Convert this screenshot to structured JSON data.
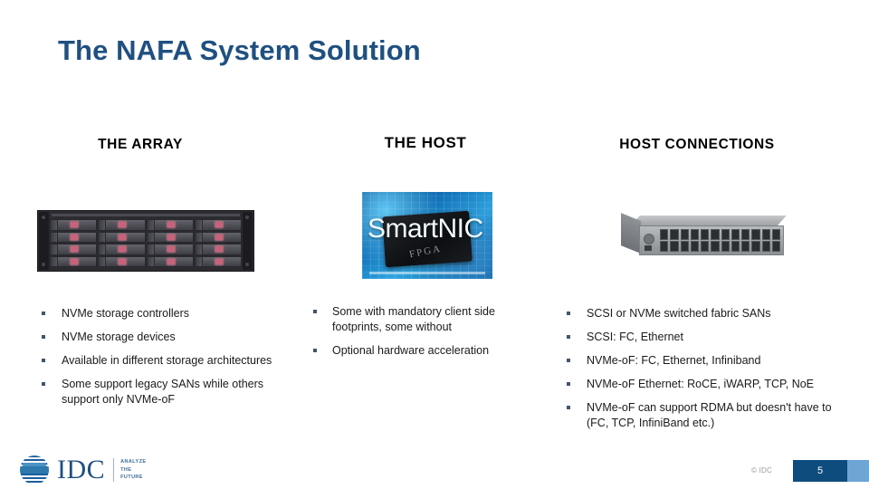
{
  "slide": {
    "title": "The NAFA System Solution"
  },
  "columns": [
    {
      "header": "THE ARRAY",
      "image": {
        "name": "storage-array-image",
        "alt": "Rack-mount NVMe storage array with 16 drive bays"
      },
      "bullets": [
        "NVMe storage controllers",
        "NVMe storage devices",
        "Available in different storage architectures",
        "Some support legacy SANs while others support only NVMe-oF"
      ]
    },
    {
      "header": "THE HOST",
      "image": {
        "name": "smartnic-image",
        "alt": "SmartNIC circuit board with FPGA chip",
        "caption": "SmartNIC",
        "chip_label": "FPGA"
      },
      "bullets": [
        "Some with mandatory client side footprints, some without",
        "Optional hardware acceleration"
      ]
    },
    {
      "header": "HOST CONNECTIONS",
      "image": {
        "name": "network-switch-image",
        "alt": "Rack-mount fibre channel / ethernet switch"
      },
      "bullets": [
        "SCSI or NVMe switched fabric SANs",
        "SCSI:  FC, Ethernet",
        "NVMe-oF:  FC, Ethernet, Infiniband",
        "NVMe-oF Ethernet:  RoCE, iWARP, TCP, NoE",
        "NVMe-oF can support RDMA but doesn't have to (FC, TCP, InfiniBand etc.)"
      ]
    }
  ],
  "footer": {
    "logo_text": "IDC",
    "tagline_line1": "ANALYZE",
    "tagline_line2": "THE",
    "tagline_line3": "FUTURE",
    "copyright": "© IDC",
    "page_number": "5"
  },
  "colors": {
    "title_blue": "#1F5080",
    "bullet_marker": "#44546A",
    "page_bar": "#0E4C7E",
    "page_bar_accent": "#6DA5D4",
    "array_led": "#C4637A"
  }
}
